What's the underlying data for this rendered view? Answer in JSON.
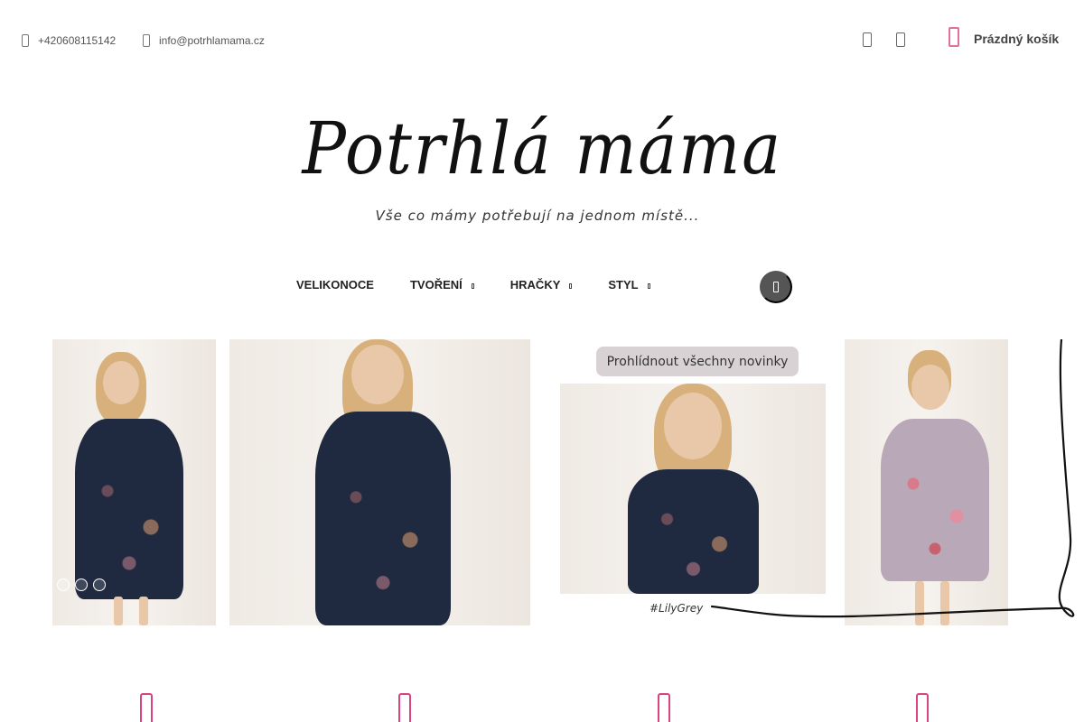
{
  "topbar": {
    "phone": "+420608115142",
    "email": "info@potrhlamama.cz",
    "cart_label": "Prázdný košík"
  },
  "branding": {
    "logo_text": "Potrhlá máma",
    "tagline": "Vše co mámy potřebují na jednom místě..."
  },
  "nav": {
    "items": [
      {
        "label": "VELIKONOCE",
        "has_submenu": false
      },
      {
        "label": "TVOŘENÍ",
        "has_submenu": true
      },
      {
        "label": "HRAČKY",
        "has_submenu": true
      },
      {
        "label": "STYL",
        "has_submenu": true
      }
    ]
  },
  "hero": {
    "badge": "Prohlídnout všechny novinky",
    "hashtag": "#LilyGrey",
    "slides": 3,
    "active_slide": 1
  },
  "colors": {
    "accent": "#d9437e",
    "cart_icon": "#e0709c",
    "search_button": "#555555",
    "badge_bg": "#d9d2d4",
    "navy_dress": "#1f2a40",
    "pink_dress": "#b8a8b8"
  },
  "icons": {
    "phone": "phone-icon",
    "email": "envelope-icon",
    "account": "user-icon",
    "wishlist": "heart-icon",
    "cart": "cart-icon",
    "search": "search-icon",
    "features": [
      "feature-icon-1",
      "feature-icon-2",
      "feature-icon-3",
      "feature-icon-4"
    ]
  }
}
